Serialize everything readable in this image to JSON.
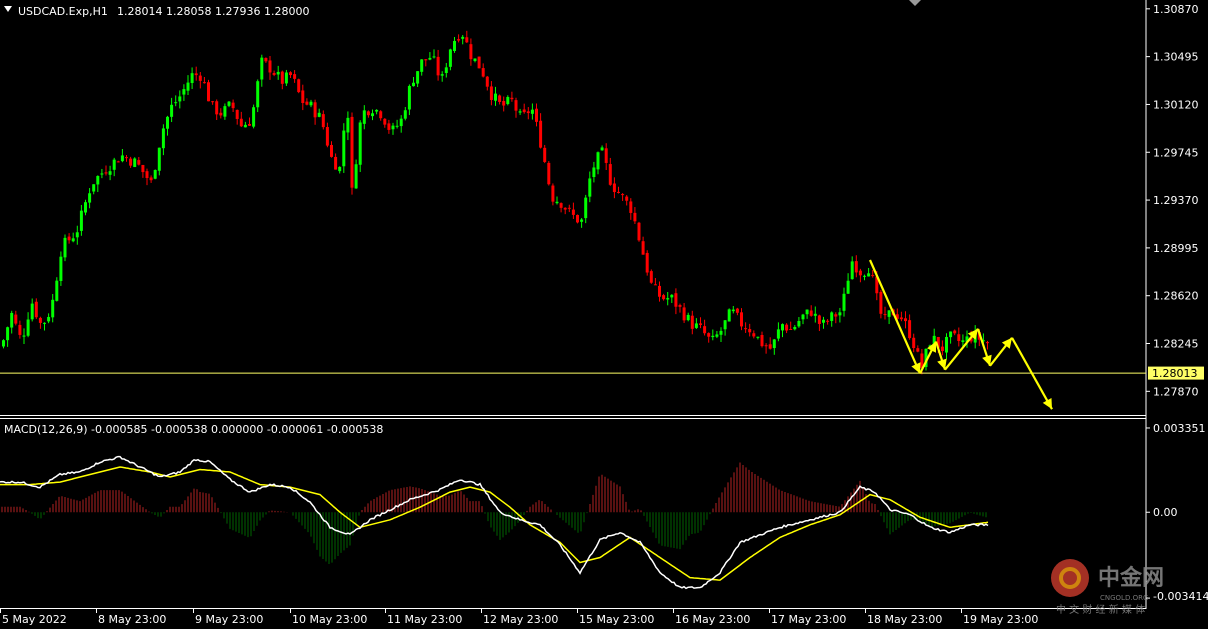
{
  "header": {
    "symbol": "USDCAD.Exp,H1",
    "ohlc": "1.28014 1.28058 1.27936 1.28000"
  },
  "macd_header": "MACD(12,26,9) -0.000585 -0.000538 0.000000 -0.000061 -0.000538",
  "watermark": {
    "brand": "中金网",
    "domain": "CNGOLD.ORG",
    "tagline": "中 文 财 经 新 媒 体"
  },
  "colors": {
    "bull": "#00ff00",
    "bear": "#ff0000",
    "price_line": "#ffff66",
    "macd_line": "#ffffff",
    "signal_line": "#ffff00",
    "hist_pos": "#b22222",
    "hist_neg": "#006400",
    "arrows": "#ffff00"
  },
  "chart_data": [
    {
      "type": "candlestick",
      "title": "USDCAD.Exp,H1",
      "ylim": [
        1.277,
        1.309
      ],
      "y_ticks": [
        "1.30870",
        "1.30495",
        "1.30120",
        "1.29745",
        "1.29370",
        "1.28995",
        "1.28620",
        "1.28245",
        "1.27870"
      ],
      "x_ticks": [
        "5 May 2022",
        "8 May 23:00",
        "9 May 23:00",
        "10 May 23:00",
        "11 May 23:00",
        "12 May 23:00",
        "15 May 23:00",
        "16 May 23:00",
        "17 May 23:00",
        "18 May 23:00",
        "19 May 23:00"
      ],
      "current_price": "1.28013",
      "path_anchors": [
        [
          0,
          1.2822
        ],
        [
          10,
          1.2848
        ],
        [
          20,
          1.2826
        ],
        [
          30,
          1.2858
        ],
        [
          40,
          1.2838
        ],
        [
          50,
          1.2852
        ],
        [
          60,
          1.29
        ],
        [
          75,
          1.2912
        ],
        [
          90,
          1.295
        ],
        [
          105,
          1.2962
        ],
        [
          120,
          1.2972
        ],
        [
          135,
          1.2966
        ],
        [
          150,
          1.295
        ],
        [
          160,
          1.299
        ],
        [
          170,
          1.301
        ],
        [
          180,
          1.302
        ],
        [
          190,
          1.3035
        ],
        [
          200,
          1.3035
        ],
        [
          210,
          1.301
        ],
        [
          220,
          1.3005
        ],
        [
          230,
          1.3012
        ],
        [
          240,
          1.2995
        ],
        [
          250,
          1.3
        ],
        [
          260,
          1.3045
        ],
        [
          270,
          1.304
        ],
        [
          280,
          1.303
        ],
        [
          290,
          1.3035
        ],
        [
          300,
          1.3015
        ],
        [
          310,
          1.301
        ],
        [
          320,
          1.3
        ],
        [
          330,
          1.297
        ],
        [
          340,
          1.296
        ],
        [
          345,
          1.303
        ],
        [
          350,
          1.294
        ],
        [
          360,
          1.3005
        ],
        [
          370,
          1.301
        ],
        [
          380,
          1.3005
        ],
        [
          390,
          1.299
        ],
        [
          400,
          1.3
        ],
        [
          410,
          1.303
        ],
        [
          420,
          1.3045
        ],
        [
          430,
          1.305
        ],
        [
          440,
          1.303
        ],
        [
          450,
          1.306
        ],
        [
          460,
          1.307
        ],
        [
          470,
          1.305
        ],
        [
          480,
          1.304
        ],
        [
          490,
          1.302
        ],
        [
          500,
          1.301
        ],
        [
          510,
          1.3015
        ],
        [
          520,
          1.3
        ],
        [
          530,
          1.301
        ],
        [
          540,
          1.298
        ],
        [
          550,
          1.294
        ],
        [
          560,
          1.2935
        ],
        [
          570,
          1.2925
        ],
        [
          580,
          1.292
        ],
        [
          590,
          1.296
        ],
        [
          600,
          1.2975
        ],
        [
          610,
          1.295
        ],
        [
          620,
          1.294
        ],
        [
          630,
          1.293
        ],
        [
          640,
          1.29
        ],
        [
          650,
          1.287
        ],
        [
          660,
          1.286
        ],
        [
          670,
          1.286
        ],
        [
          680,
          1.285
        ],
        [
          690,
          1.284
        ],
        [
          700,
          1.2835
        ],
        [
          710,
          1.2825
        ],
        [
          720,
          1.2835
        ],
        [
          730,
          1.285
        ],
        [
          740,
          1.284
        ],
        [
          750,
          1.2835
        ],
        [
          760,
          1.2825
        ],
        [
          770,
          1.282
        ],
        [
          780,
          1.284
        ],
        [
          790,
          1.2835
        ],
        [
          800,
          1.2845
        ],
        [
          810,
          1.285
        ],
        [
          820,
          1.2838
        ],
        [
          830,
          1.2845
        ],
        [
          840,
          1.285
        ],
        [
          850,
          1.289
        ],
        [
          860,
          1.288
        ],
        [
          868,
          1.2885
        ],
        [
          875,
          1.286
        ],
        [
          882,
          1.284
        ],
        [
          890,
          1.285
        ],
        [
          900,
          1.2845
        ],
        [
          910,
          1.283
        ],
        [
          920,
          1.2805
        ],
        [
          930,
          1.283
        ],
        [
          940,
          1.282
        ],
        [
          950,
          1.283
        ],
        [
          960,
          1.2825
        ],
        [
          970,
          1.283
        ],
        [
          980,
          1.2828
        ],
        [
          988,
          1.2824
        ]
      ],
      "annotation_path": [
        [
          870,
          1.289
        ],
        [
          920,
          1.2801
        ],
        [
          936,
          1.2826
        ],
        [
          945,
          1.2804
        ],
        [
          978,
          1.2836
        ],
        [
          990,
          1.2807
        ],
        [
          1012,
          1.2829
        ],
        [
          1052,
          1.2773
        ]
      ]
    },
    {
      "type": "macd",
      "title": "MACD(12,26,9)",
      "ylim": [
        -0.00341,
        0.00335
      ],
      "y_ticks": [
        "0.003351",
        "0.00",
        "-0.003414"
      ],
      "macd_anchors": [
        [
          0,
          0.0012
        ],
        [
          20,
          0.0012
        ],
        [
          40,
          0.001
        ],
        [
          60,
          0.0015
        ],
        [
          80,
          0.0016
        ],
        [
          100,
          0.002
        ],
        [
          120,
          0.0022
        ],
        [
          140,
          0.0018
        ],
        [
          160,
          0.0014
        ],
        [
          180,
          0.0016
        ],
        [
          195,
          0.0021
        ],
        [
          210,
          0.002
        ],
        [
          230,
          0.0013
        ],
        [
          250,
          0.0008
        ],
        [
          270,
          0.0011
        ],
        [
          290,
          0.001
        ],
        [
          310,
          0.0004
        ],
        [
          330,
          -0.0006
        ],
        [
          350,
          -0.0009
        ],
        [
          370,
          -0.0003
        ],
        [
          390,
          0.0001
        ],
        [
          410,
          0.0005
        ],
        [
          440,
          0.0009
        ],
        [
          460,
          0.0013
        ],
        [
          480,
          0.0011
        ],
        [
          500,
          0.0
        ],
        [
          520,
          -0.0003
        ],
        [
          540,
          -0.0005
        ],
        [
          560,
          -0.0013
        ],
        [
          580,
          -0.0024
        ],
        [
          600,
          -0.0011
        ],
        [
          620,
          -0.0008
        ],
        [
          640,
          -0.0012
        ],
        [
          660,
          -0.0024
        ],
        [
          680,
          -0.003
        ],
        [
          700,
          -0.003
        ],
        [
          720,
          -0.0024
        ],
        [
          740,
          -0.0012
        ],
        [
          760,
          -0.0009
        ],
        [
          780,
          -0.0006
        ],
        [
          800,
          -0.0004
        ],
        [
          820,
          -0.0002
        ],
        [
          840,
          0.0
        ],
        [
          860,
          0.001
        ],
        [
          875,
          0.0008
        ],
        [
          890,
          0.0001
        ],
        [
          910,
          -0.0001
        ],
        [
          930,
          -0.0006
        ],
        [
          950,
          -0.0008
        ],
        [
          970,
          -0.0005
        ],
        [
          988,
          -0.0005
        ]
      ],
      "signal_anchors": [
        [
          0,
          0.0011
        ],
        [
          30,
          0.0011
        ],
        [
          60,
          0.0012
        ],
        [
          90,
          0.0015
        ],
        [
          120,
          0.0018
        ],
        [
          150,
          0.0016
        ],
        [
          170,
          0.0014
        ],
        [
          200,
          0.0017
        ],
        [
          230,
          0.0016
        ],
        [
          260,
          0.0011
        ],
        [
          290,
          0.001
        ],
        [
          320,
          0.0007
        ],
        [
          340,
          0.0
        ],
        [
          360,
          -0.0006
        ],
        [
          390,
          -0.0003
        ],
        [
          420,
          0.0002
        ],
        [
          450,
          0.0008
        ],
        [
          470,
          0.001
        ],
        [
          490,
          0.0008
        ],
        [
          510,
          0.0002
        ],
        [
          530,
          -0.0005
        ],
        [
          560,
          -0.0012
        ],
        [
          580,
          -0.002
        ],
        [
          600,
          -0.0018
        ],
        [
          630,
          -0.001
        ],
        [
          660,
          -0.0018
        ],
        [
          690,
          -0.0026
        ],
        [
          720,
          -0.0027
        ],
        [
          750,
          -0.0018
        ],
        [
          780,
          -0.001
        ],
        [
          810,
          -0.0005
        ],
        [
          840,
          -0.0001
        ],
        [
          870,
          0.0007
        ],
        [
          890,
          0.0005
        ],
        [
          920,
          -0.0002
        ],
        [
          950,
          -0.0006
        ],
        [
          988,
          -0.0004
        ]
      ]
    }
  ]
}
